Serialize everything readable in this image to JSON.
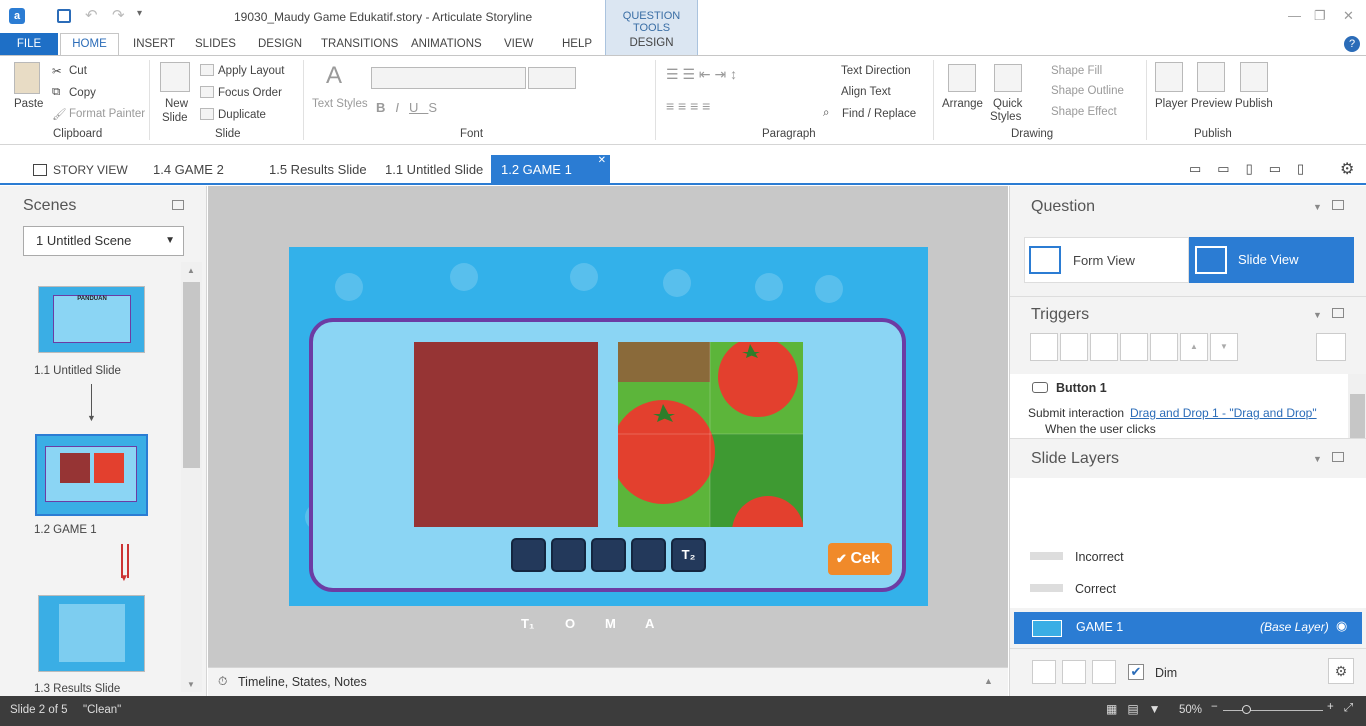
{
  "window": {
    "title": "19030_Maudy Game Edukatif.story - Articulate Storyline",
    "contextual_tab_group": "QUESTION TOOLS",
    "contextual_tab": "DESIGN"
  },
  "ribbon_tabs": [
    "FILE",
    "HOME",
    "INSERT",
    "SLIDES",
    "DESIGN",
    "TRANSITIONS",
    "ANIMATIONS",
    "VIEW",
    "HELP"
  ],
  "ribbon": {
    "clipboard": {
      "paste": "Paste",
      "cut": "Cut",
      "copy": "Copy",
      "format_painter": "Format Painter",
      "label": "Clipboard"
    },
    "slide": {
      "new_slide_1": "New",
      "new_slide_2": "Slide",
      "apply_layout": "Apply Layout",
      "focus_order": "Focus Order",
      "duplicate": "Duplicate",
      "label": "Slide"
    },
    "font": {
      "text_styles": "Text Styles",
      "label": "Font"
    },
    "paragraph": {
      "text_direction": "Text Direction",
      "align_text": "Align Text",
      "find_replace": "Find / Replace",
      "label": "Paragraph"
    },
    "drawing": {
      "arrange": "Arrange",
      "quick_styles_1": "Quick",
      "quick_styles_2": "Styles",
      "shape_fill": "Shape Fill",
      "shape_outline": "Shape Outline",
      "shape_effect": "Shape Effect",
      "label": "Drawing"
    },
    "publish": {
      "player": "Player",
      "preview": "Preview",
      "publish": "Publish",
      "label": "Publish"
    }
  },
  "doc_tabs": [
    {
      "label": "STORY VIEW"
    },
    {
      "label": "1.4 GAME 2"
    },
    {
      "label": "1.5 Results Slide"
    },
    {
      "label": "1.1 Untitled Slide"
    },
    {
      "label": "1.2 GAME 1"
    }
  ],
  "scenes": {
    "title": "Scenes",
    "selected_scene": "1 Untitled Scene",
    "slides": [
      {
        "label": "1.1 Untitled Slide",
        "thumb_title": "PANDUAN"
      },
      {
        "label": "1.2 GAME 1"
      },
      {
        "label": "1.3 Results Slide"
      }
    ]
  },
  "slide": {
    "tile_label": "T₂",
    "check_button": "Cek",
    "letters": [
      "T₁",
      "O",
      "M",
      "A"
    ]
  },
  "timeline_label": "Timeline, States, Notes",
  "question_panel": {
    "title": "Question",
    "form_view": "Form View",
    "slide_view": "Slide View"
  },
  "triggers_panel": {
    "title": "Triggers",
    "object": "Button 1",
    "action": "Submit interaction",
    "link": "Drag and Drop 1 - \"Drag and Drop\"",
    "condition": "When the user clicks"
  },
  "layers_panel": {
    "title": "Slide Layers",
    "layers": [
      {
        "name": "Incorrect"
      },
      {
        "name": "Correct"
      }
    ],
    "base": {
      "name": "GAME 1",
      "tag": "(Base Layer)"
    },
    "dim_label": "Dim"
  },
  "status": {
    "slide": "Slide 2 of 5",
    "theme": "\"Clean\"",
    "zoom": "50%"
  },
  "colors": {
    "accent": "#2b7cd3",
    "file_tab": "#1e6fc6",
    "slide_bg": "#33b1ea",
    "frame": "#6c3ca4",
    "tomato_block": "#963434",
    "check_button": "#f08a2a"
  }
}
